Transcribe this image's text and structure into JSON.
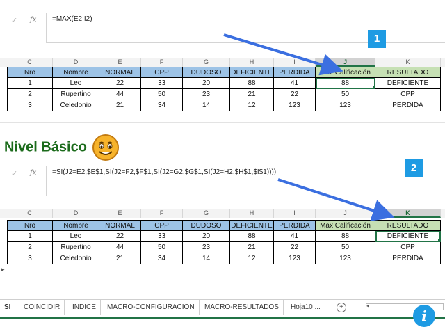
{
  "formula_bar_1": {
    "cancel_icon": "✓",
    "fx_label": "fx",
    "formula": "=MAX(E2:I2)"
  },
  "formula_bar_2": {
    "cancel_icon": "✓",
    "fx_label": "fx",
    "formula": "=SI(J2=E2,$E$1,SI(J2=F2,$F$1,SI(J2=G2,$G$1,SI(J2=H2,$H$1,$I$1))))"
  },
  "columns": [
    "C",
    "D",
    "E",
    "F",
    "G",
    "H",
    "I",
    "J",
    "K"
  ],
  "table_headers": [
    "Nro",
    "Nombre",
    "NORMAL",
    "CPP",
    "DUDOSO",
    "DEFICIENTE",
    "PERDIDA",
    "Max Calificación",
    "RESULTADO"
  ],
  "rows": [
    [
      "1",
      "Leo",
      "22",
      "33",
      "20",
      "88",
      "41",
      "88",
      "DEFICIENTE"
    ],
    [
      "2",
      "Rupertino",
      "44",
      "50",
      "23",
      "21",
      "22",
      "50",
      "CPP"
    ],
    [
      "3",
      "Celedonio",
      "21",
      "34",
      "14",
      "12",
      "123",
      "123",
      "PERDIDA"
    ]
  ],
  "badge_1": "1",
  "badge_2": "2",
  "nivel_text": "Nivel Básico",
  "sheet_tabs": {
    "partial": "SI",
    "items": [
      "COINCIDIR",
      "INDICE",
      "MACRO-CONFIGURACION",
      "MACRO-RESULTADOS",
      "Hoja10 ..."
    ],
    "add_icon": "+"
  },
  "info_icon": "i",
  "colors": {
    "header_blue": "#9dc3e6",
    "header_green": "#c6e0b4",
    "excel_green": "#217346",
    "badge_blue": "#1e9be3",
    "arrow_blue": "#3b6fe0"
  }
}
